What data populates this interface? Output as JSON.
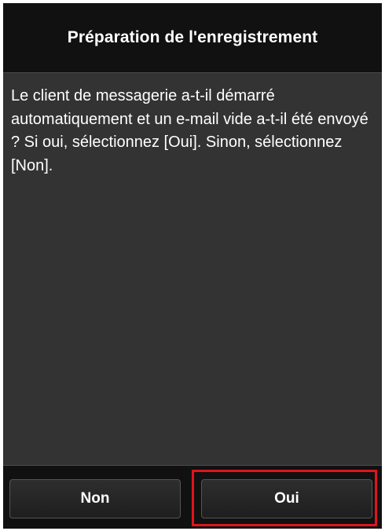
{
  "dialog": {
    "title": "Préparation de l'enregistrement",
    "message": "Le client de messagerie a-t-il démarré automatiquement et un e-mail vide a-t-il été envoyé ? Si oui, sélectionnez [Oui]. Sinon, sélectionnez [Non]."
  },
  "buttons": {
    "no_label": "Non",
    "yes_label": "Oui"
  },
  "colors": {
    "dialog_background": "#333333",
    "bar_background": "#111111",
    "highlight_border": "#e0141c",
    "text": "#ffffff"
  }
}
